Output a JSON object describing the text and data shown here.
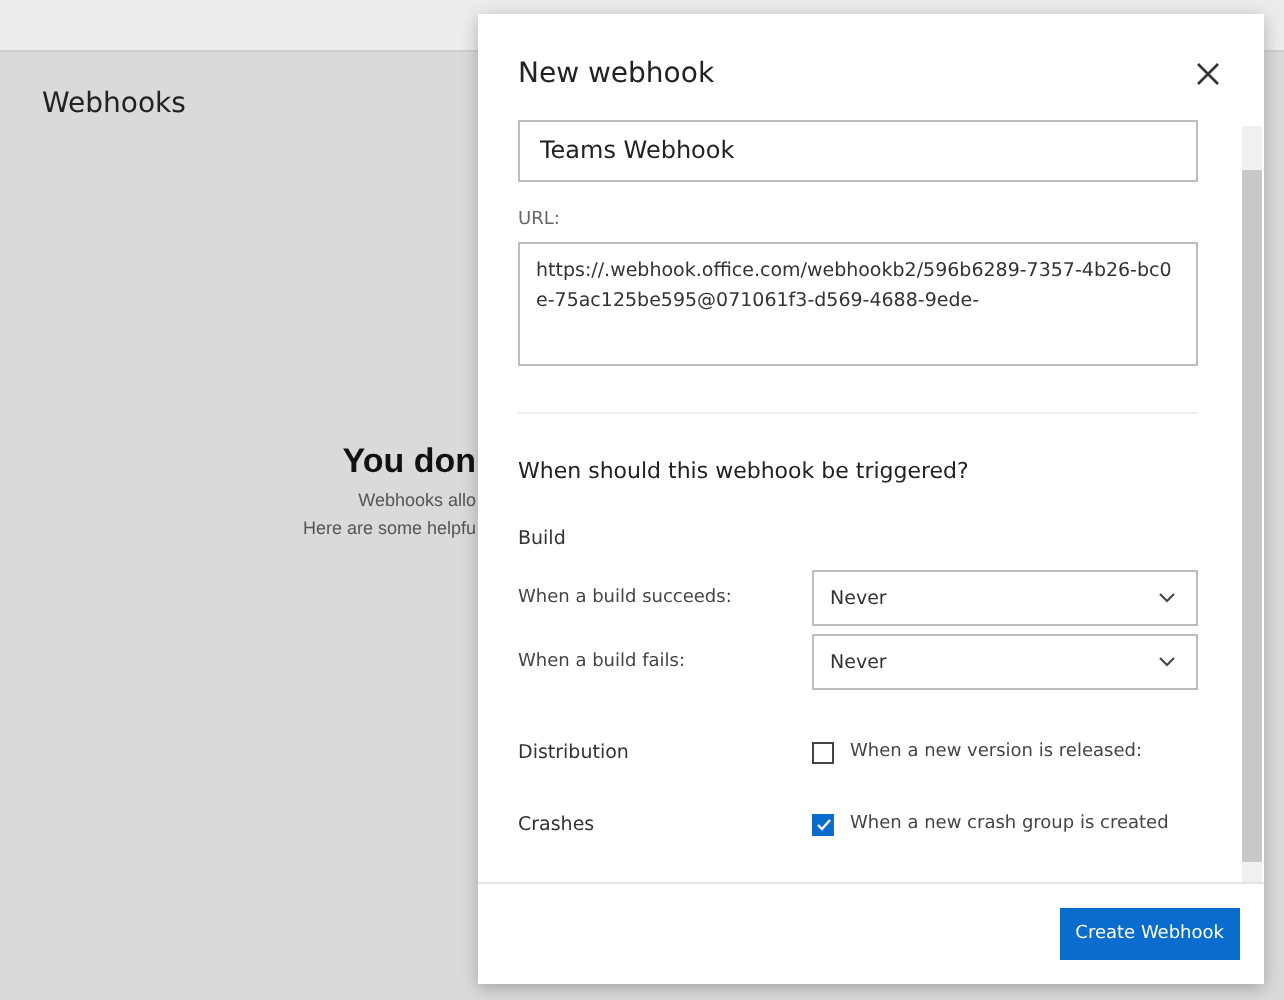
{
  "page": {
    "title": "Webhooks",
    "empty_heading": "You don",
    "empty_lines": [
      "Webhooks allo",
      "Here are some helpfu"
    ]
  },
  "dialog": {
    "title": "New webhook",
    "name_value": "Teams Webhook",
    "url_label": "URL:",
    "url_value": "https://.webhook.office.com/webhookb2/596b6289-7357-4b26-bc0e-75ac125be595@071061f3-d569-4688-9ede-",
    "section_title": "When should this webhook be triggered?",
    "groups": [
      {
        "title": "Build",
        "rows": [
          {
            "kind": "select",
            "label": "When a build succeeds:",
            "value": "Never"
          },
          {
            "kind": "select",
            "label": "When a build fails:",
            "value": "Never"
          }
        ]
      },
      {
        "title": "Distribution",
        "rows": [
          {
            "kind": "checkbox",
            "label": "When a new version is released:",
            "checked": false
          }
        ]
      },
      {
        "title": "Crashes",
        "rows": [
          {
            "kind": "checkbox",
            "label": "When a new crash group is created",
            "checked": true
          }
        ]
      }
    ],
    "primary_button": "Create Webhook"
  }
}
